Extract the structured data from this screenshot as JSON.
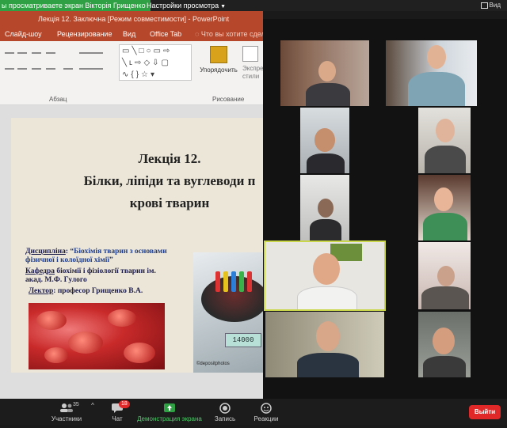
{
  "banner": {
    "share_text": "ы просматриваете экран Вікторія Грищенко",
    "view_settings_label": "Настройки просмотра",
    "view_label": "Вид"
  },
  "powerpoint": {
    "window_title": "Лекція 12. Заключна [Режим совместимости] - PowerPoint",
    "tabs": [
      "Слайд-шоу",
      "Рецензирование",
      "Вид",
      "Office Tab"
    ],
    "tell_me": "Что вы хотите сдел",
    "ribbon": {
      "group_paragraph": "Абзац",
      "group_drawing": "Рисование",
      "arrange_label": "Упорядочить",
      "express_label_1": "Экспресс",
      "express_label_2": "стили"
    },
    "slide": {
      "title_line1": "Лекція 12.",
      "title_line2": "Білки, ліпіди та вуглеводи п",
      "title_line3": "крові тварин",
      "discipline_label": "Дисципліна",
      "discipline_value_1": "“Біохімія тварин з основами",
      "discipline_value_2": "фізичної і колоїдної хімії”",
      "department_label": "Кафедра",
      "department_value_1": "біохімії і фізіології тварин  ім.",
      "department_value_2": "акад. М.Ф. Гулого",
      "lecturer_label": "Лектор",
      "lecturer_value": "професор Грищенко В.А.",
      "centrifuge_display": "14000",
      "centrifuge_brand": "©depositphotos"
    }
  },
  "toolbar": {
    "participants_label": "Участники",
    "participants_count": "35",
    "chat_label": "Чат",
    "chat_badge": "18",
    "share_label": "Демонстрация экрана",
    "record_label": "Запись",
    "reactions_label": "Реакции",
    "leave_label": "Выйти"
  }
}
